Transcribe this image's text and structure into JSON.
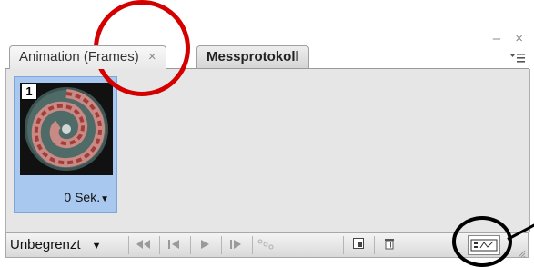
{
  "window": {
    "controls": [
      "–",
      "×"
    ]
  },
  "tabs": [
    {
      "label": "Animation (Frames)",
      "active": true,
      "close": "×"
    },
    {
      "label": "Messprotokoll",
      "active": false
    }
  ],
  "panel_menu_icon": "panel-menu-icon",
  "frames": [
    {
      "number": "1",
      "delay": "0 Sek.",
      "selected": true
    }
  ],
  "toolbar": {
    "loop_label": "Unbegrenzt",
    "buttons": [
      "first-frame-icon",
      "previous-frame-icon",
      "play-icon",
      "next-frame-icon",
      "tween-icon",
      "new-frame-icon",
      "trash-icon",
      "convert-to-timeline-icon"
    ]
  },
  "annotations": {
    "red_circle_color": "#d40000",
    "black_circle_color": "#000000"
  }
}
